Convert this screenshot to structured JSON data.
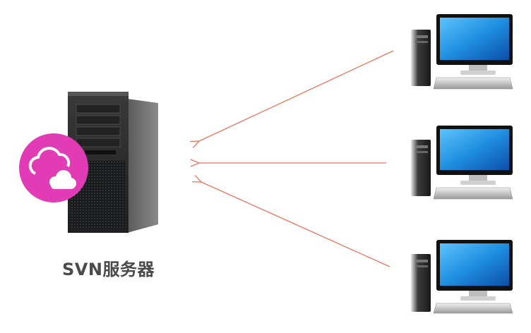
{
  "server": {
    "label": "SVN服务器",
    "badge_icon": "cloud-icon",
    "badge_color": "#e13cb5"
  },
  "clients": [
    {
      "name": "client-computer-1",
      "icon": "desktop-computer-icon"
    },
    {
      "name": "client-computer-2",
      "icon": "desktop-computer-icon"
    },
    {
      "name": "client-computer-3",
      "icon": "desktop-computer-icon"
    }
  ],
  "connections": [
    {
      "from": "client-computer-1",
      "to": "server"
    },
    {
      "from": "client-computer-2",
      "to": "server"
    },
    {
      "from": "client-computer-3",
      "to": "server"
    }
  ],
  "colors": {
    "arrow": "#e8735e",
    "screen": "#1f8fe0",
    "device_body": "#2b2b2b"
  }
}
